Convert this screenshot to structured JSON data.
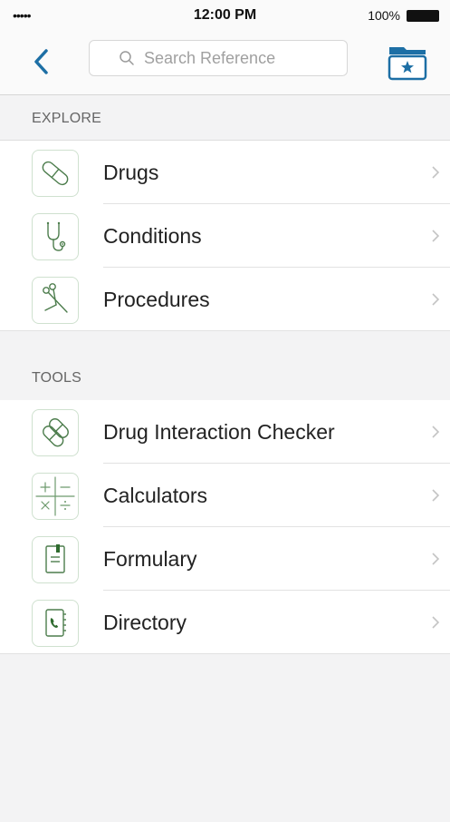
{
  "status_bar": {
    "signal": "•••••",
    "time": "12:00 PM",
    "battery": "100%"
  },
  "nav": {
    "search_placeholder": "Search Reference"
  },
  "sections": [
    {
      "title": "EXPLORE",
      "items": [
        {
          "label": "Drugs",
          "icon": "pill-icon"
        },
        {
          "label": "Conditions",
          "icon": "stethoscope-icon"
        },
        {
          "label": "Procedures",
          "icon": "scissors-icon"
        }
      ]
    },
    {
      "title": "TOOLS",
      "items": [
        {
          "label": "Drug Interaction Checker",
          "icon": "two-pills-icon"
        },
        {
          "label": "Calculators",
          "icon": "calculator-icon"
        },
        {
          "label": "Formulary",
          "icon": "document-icon"
        },
        {
          "label": "Directory",
          "icon": "phone-book-icon"
        }
      ]
    }
  ],
  "colors": {
    "accent": "#1d6fa5",
    "icon_green": "#4d7d4d",
    "icon_border": "#cfe1cf",
    "background": "#f3f3f4"
  }
}
